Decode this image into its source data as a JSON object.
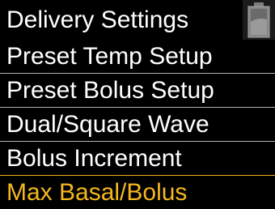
{
  "header": {
    "title": "Delivery Settings",
    "status_icon": "battery-icon"
  },
  "menu": {
    "items": [
      {
        "label": "Preset Temp Setup",
        "selected": false
      },
      {
        "label": "Preset Bolus Setup",
        "selected": false
      },
      {
        "label": "Dual/Square Wave",
        "selected": false
      },
      {
        "label": "Bolus Increment",
        "selected": false
      },
      {
        "label": "Max Basal/Bolus",
        "selected": true
      }
    ]
  },
  "colors": {
    "background": "#000000",
    "text": "#ffffff",
    "divider": "#b3b3b3",
    "highlight": "#f5b81f"
  }
}
